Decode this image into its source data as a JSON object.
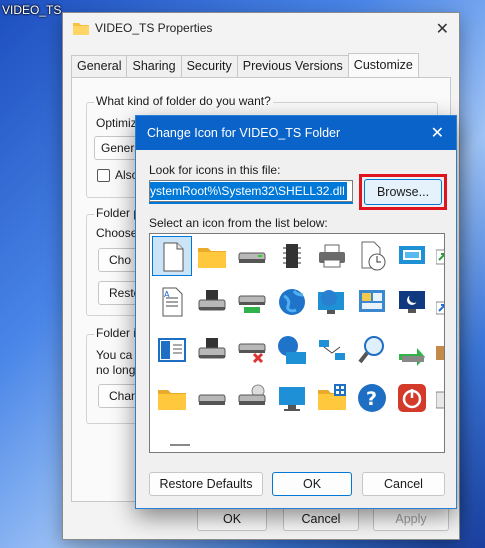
{
  "desktop": {
    "label": "VIDEO_TS"
  },
  "properties": {
    "title": "VIDEO_TS Properties",
    "tabs": [
      "General",
      "Sharing",
      "Security",
      "Previous Versions",
      "Customize"
    ],
    "active_tab": "Customize",
    "group1_label": "What kind of folder do you want?",
    "optimize_label": "Optimize this folder for:",
    "optimize_value": "Genera",
    "also_apply_label": "Also a",
    "group2_label": "Folder p",
    "choose_label": "Choose",
    "choose_button": "Cho",
    "restore_button": "Resto",
    "group3_label": "Folder ic",
    "change_text_1": "You ca",
    "change_text_2": "no longe",
    "change_button": "Chan",
    "ok": "OK",
    "cancel": "Cancel",
    "apply": "Apply"
  },
  "dialog": {
    "title": "Change Icon for VIDEO_TS Folder",
    "look_label": "Look for icons in this file:",
    "path_value": "ystemRoot%\\System32\\SHELL32.dll",
    "browse_label": "Browse...",
    "select_label": "Select an icon from the list below:",
    "restore_defaults": "Restore Defaults",
    "ok": "OK",
    "cancel": "Cancel",
    "highlight_color": "#e0141e",
    "accent_color": "#0a63c9"
  },
  "icons": [
    [
      "blank-document-icon",
      "folder-icon",
      "hard-drive-icon",
      "memory-chip-icon",
      "printer-icon",
      "document-clock-icon",
      "monitor-window-icon",
      "green-arrow-icon"
    ],
    [
      "text-document-icon",
      "floppy-drive-icon",
      "drive-green-light-icon",
      "globe-icon",
      "globe-monitor-icon",
      "control-panel-icon",
      "monitor-moon-icon",
      "shortcut-arrow-icon"
    ],
    [
      "window-layout-icon",
      "floppy-drive-2-icon",
      "drive-disconnected-icon",
      "network-globe-icon",
      "network-connections-icon",
      "magnifier-icon",
      "recycle-arrow-icon",
      "box-icon"
    ],
    [
      "open-folder-icon",
      "hard-drive-2-icon",
      "disc-drive-icon",
      "monitor-icon",
      "folder-grid-icon",
      "help-icon",
      "power-icon",
      "partial-icon"
    ]
  ]
}
